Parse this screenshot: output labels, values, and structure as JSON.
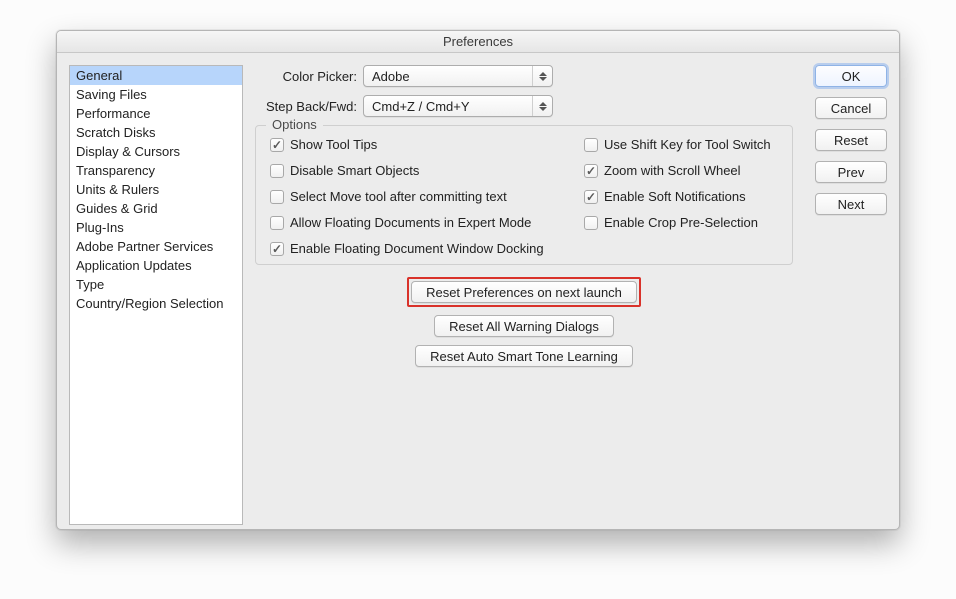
{
  "title": "Preferences",
  "sidebar": {
    "items": [
      {
        "label": "General",
        "selected": true
      },
      {
        "label": "Saving Files"
      },
      {
        "label": "Performance"
      },
      {
        "label": "Scratch Disks"
      },
      {
        "label": "Display & Cursors"
      },
      {
        "label": "Transparency"
      },
      {
        "label": "Units & Rulers"
      },
      {
        "label": "Guides & Grid"
      },
      {
        "label": "Plug-Ins"
      },
      {
        "label": "Adobe Partner Services"
      },
      {
        "label": "Application Updates"
      },
      {
        "label": "Type"
      },
      {
        "label": "Country/Region Selection"
      }
    ]
  },
  "main": {
    "color_picker": {
      "label": "Color Picker:",
      "value": "Adobe"
    },
    "step_back_fwd": {
      "label": "Step Back/Fwd:",
      "value": "Cmd+Z / Cmd+Y"
    },
    "options_legend": "Options",
    "options_left": [
      {
        "label": "Show Tool Tips",
        "checked": true
      },
      {
        "label": "Disable Smart Objects",
        "checked": false
      },
      {
        "label": "Select Move tool after committing text",
        "checked": false
      },
      {
        "label": "Allow Floating Documents in Expert Mode",
        "checked": false
      },
      {
        "label": "Enable Floating Document Window Docking",
        "checked": true
      }
    ],
    "options_right": [
      {
        "label": "Use Shift Key for Tool Switch",
        "checked": false
      },
      {
        "label": "Zoom with Scroll Wheel",
        "checked": true
      },
      {
        "label": "Enable Soft Notifications",
        "checked": true
      },
      {
        "label": "Enable Crop Pre-Selection",
        "checked": false
      }
    ],
    "center_buttons": {
      "reset_prefs": "Reset Preferences on next launch",
      "reset_warnings": "Reset All Warning Dialogs",
      "reset_smart_tone": "Reset Auto Smart Tone Learning"
    }
  },
  "right": {
    "ok": "OK",
    "cancel": "Cancel",
    "reset": "Reset",
    "prev": "Prev",
    "next": "Next"
  }
}
